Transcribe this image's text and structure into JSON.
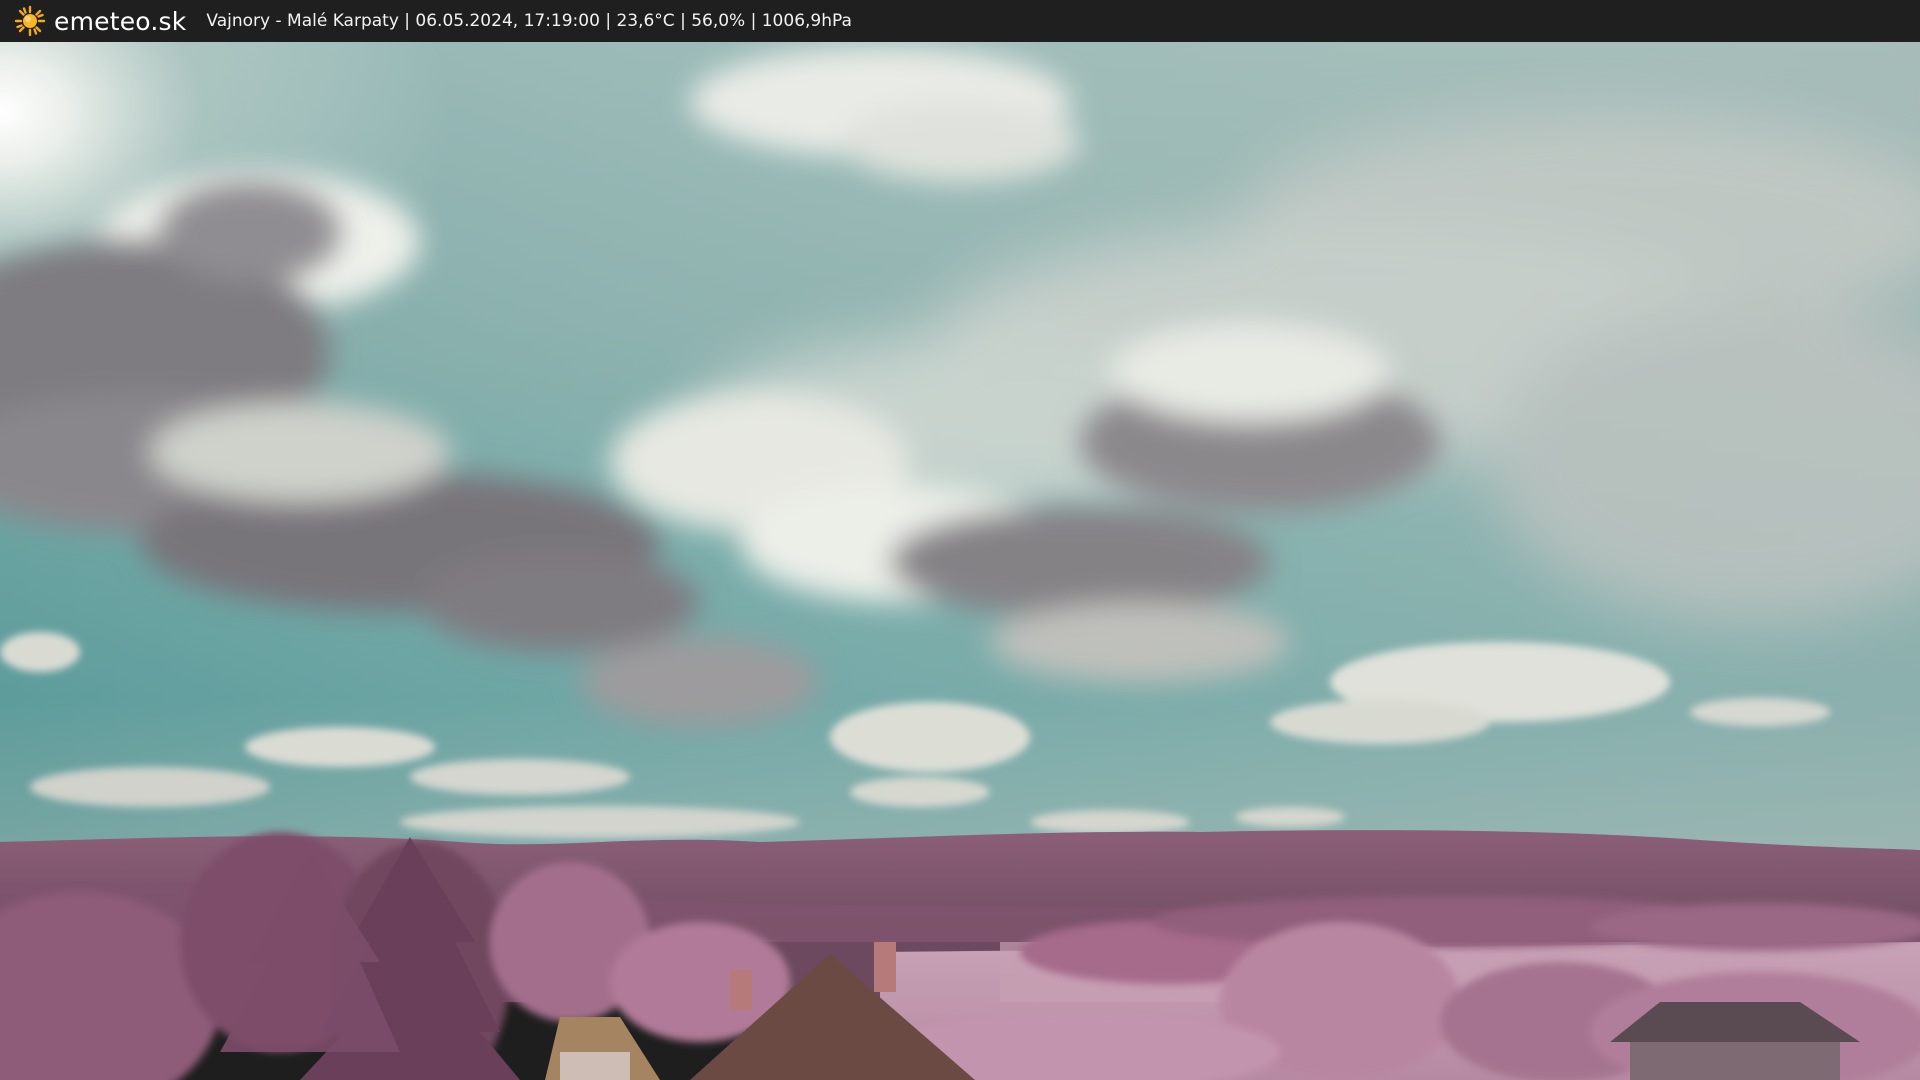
{
  "header": {
    "logo_text": "emeteo.sk",
    "logo_icon": "sun-icon",
    "caption": "Vajnory - Malé Karpaty | 06.05.2024, 17:19:00 | 23,6°C | 56,0% | 1006,9hPa"
  },
  "colors": {
    "topbar": "#1f1f1f",
    "sun": "#f5a91c",
    "sky_teal": "#5f9e9c",
    "foliage_pink": "#a46c8a"
  }
}
